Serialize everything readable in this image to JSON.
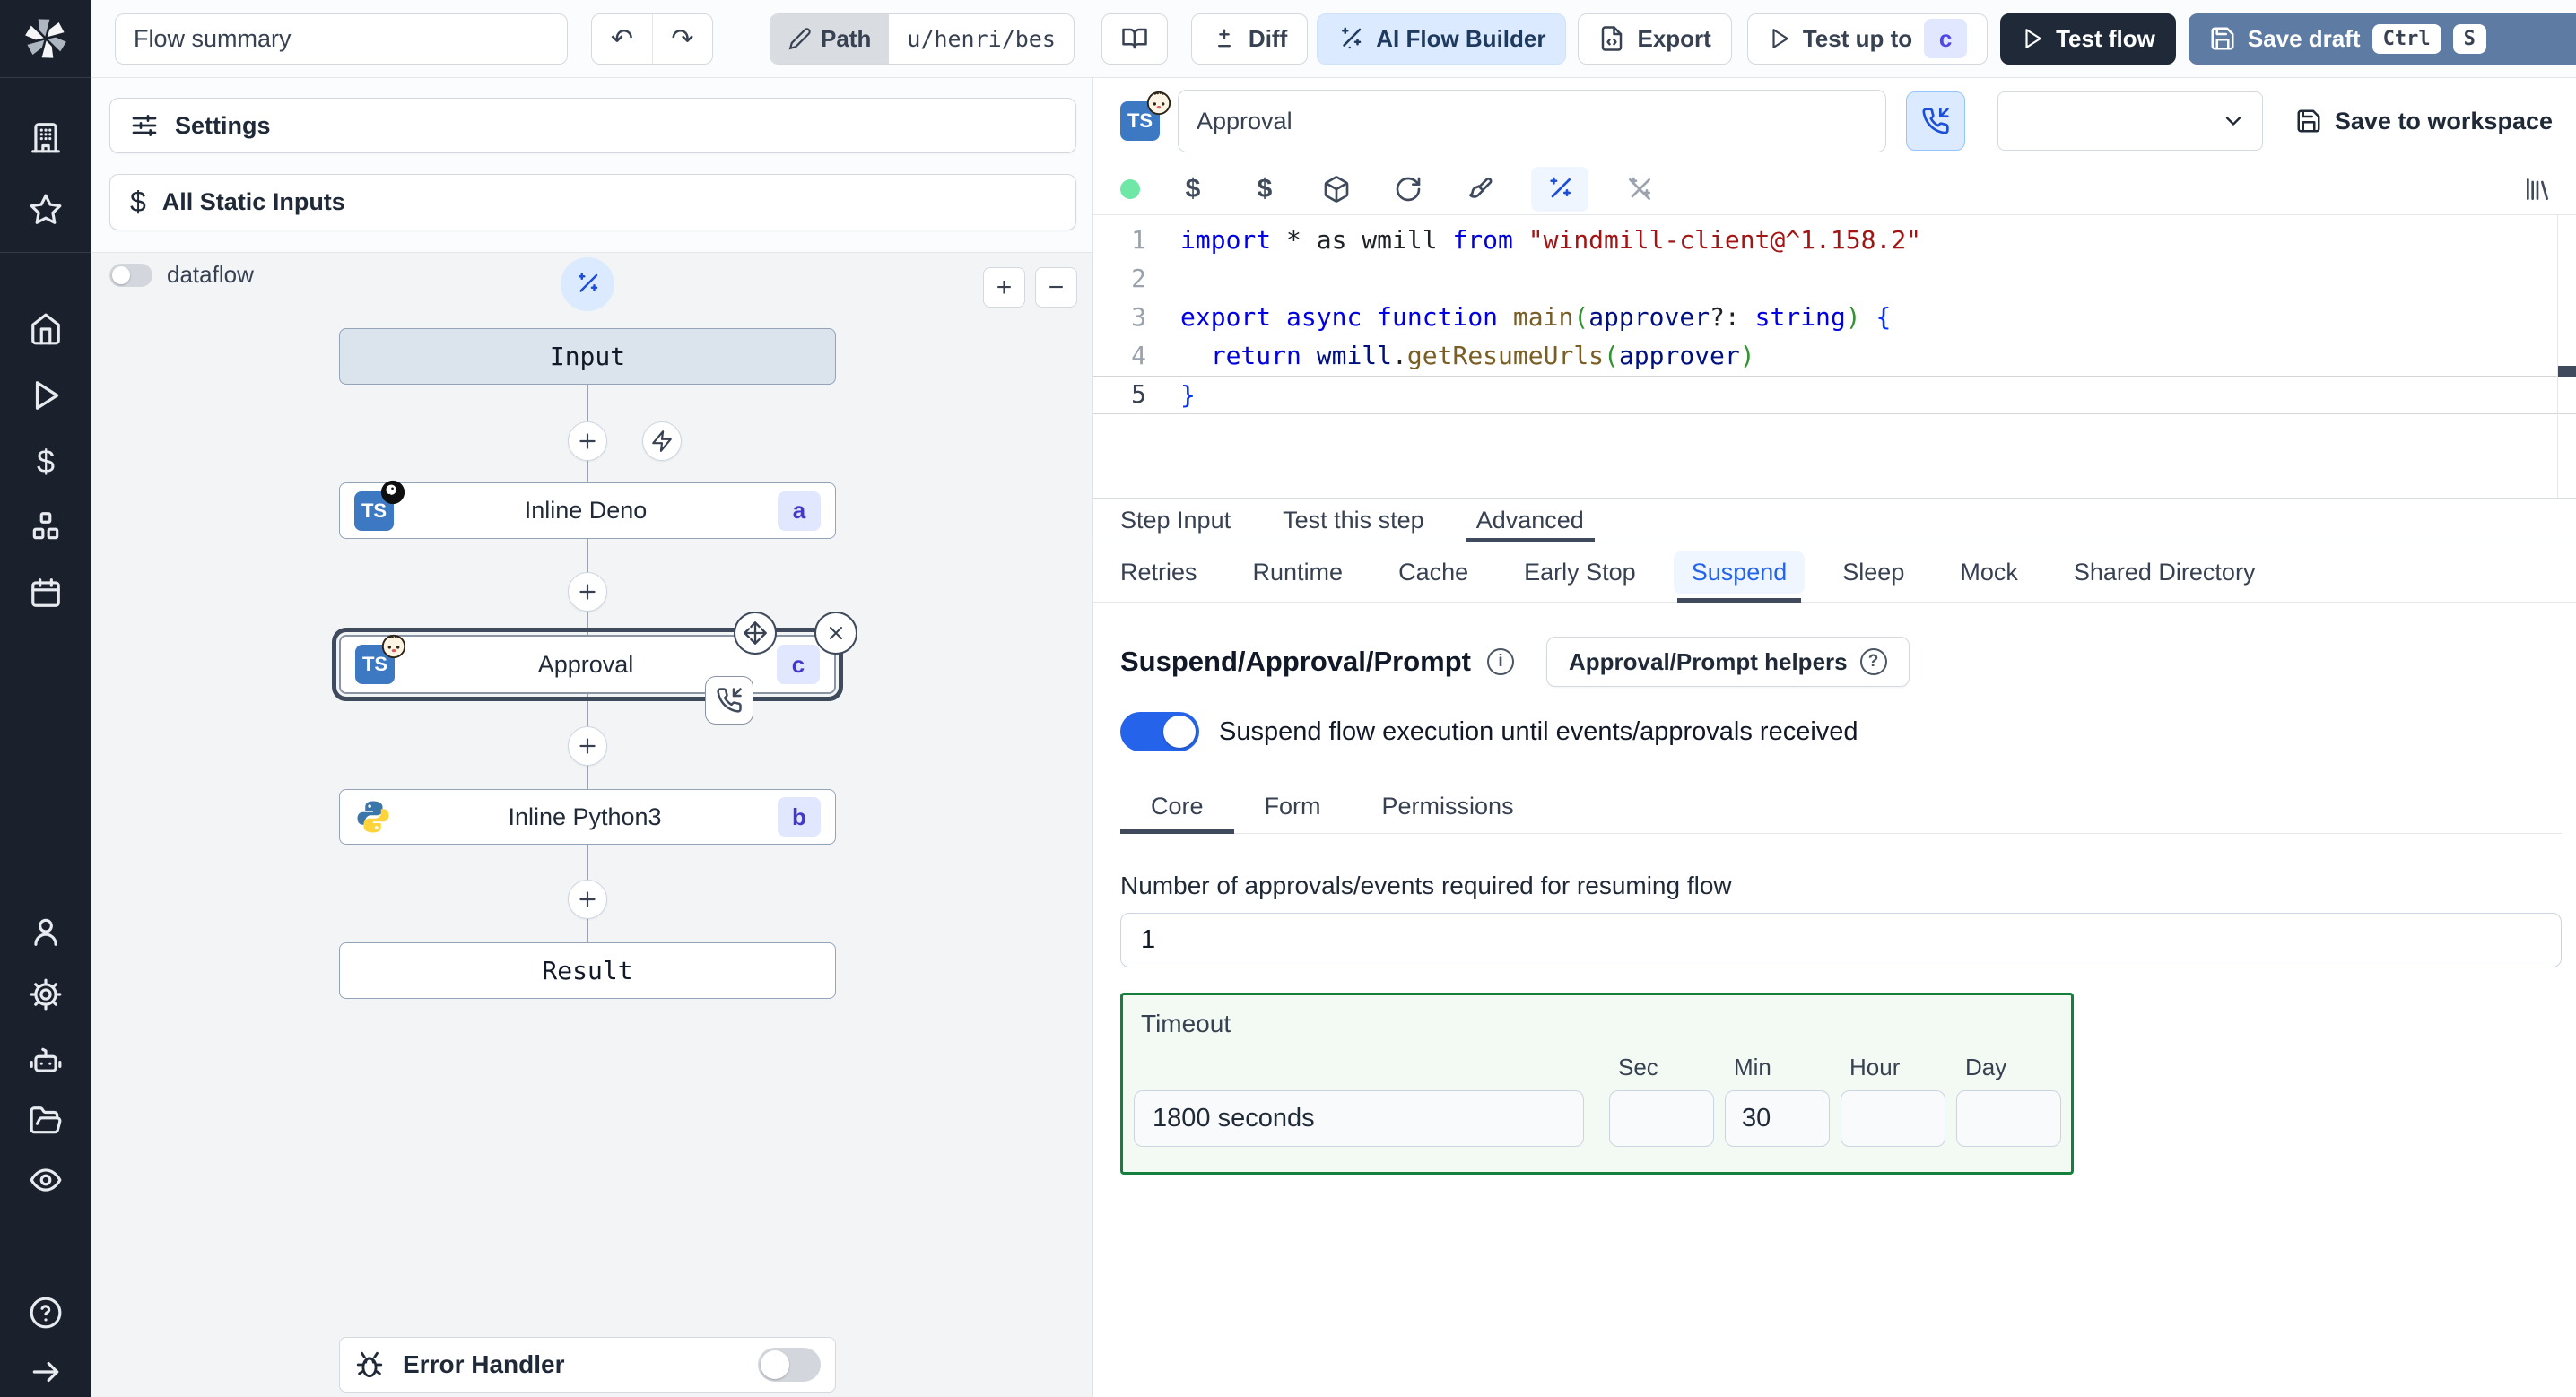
{
  "topbar": {
    "flow_summary": "Flow summary",
    "path_label": "Path",
    "path_value": "u/henri/bes",
    "diff_label": "Diff",
    "ai_builder_label": "AI Flow Builder",
    "export_label": "Export",
    "test_up_to_label": "Test up to",
    "test_up_to_badge": "c",
    "test_flow_label": "Test flow",
    "save_draft_label": "Save draft",
    "kbd_ctrl": "Ctrl",
    "kbd_s": "S"
  },
  "left": {
    "settings": "Settings",
    "all_static_inputs": "All Static Inputs",
    "dataflow": "dataflow",
    "zoom_in": "+",
    "zoom_out": "−",
    "error_handler": "Error Handler"
  },
  "graph": {
    "input_label": "Input",
    "steps": [
      {
        "label": "Inline Deno",
        "badge": "a"
      },
      {
        "label": "Approval",
        "badge": "c"
      },
      {
        "label": "Inline Python3",
        "badge": "b"
      }
    ],
    "result_label": "Result"
  },
  "header": {
    "step_name": "Approval",
    "save_to_workspace": "Save to workspace"
  },
  "editor": {
    "current_line": 5,
    "lines": [
      {
        "n": "1",
        "tokens": [
          {
            "c": "kw",
            "t": "import"
          },
          {
            "c": "pl",
            "t": " * as wmill "
          },
          {
            "c": "kw",
            "t": "from"
          },
          {
            "c": "pl",
            "t": " "
          },
          {
            "c": "str",
            "t": "\"windmill-client@^1.158.2\""
          }
        ]
      },
      {
        "n": "2",
        "tokens": []
      },
      {
        "n": "3",
        "tokens": [
          {
            "c": "kw",
            "t": "export"
          },
          {
            "c": "pl",
            "t": " "
          },
          {
            "c": "kw",
            "t": "async"
          },
          {
            "c": "pl",
            "t": " "
          },
          {
            "c": "kw",
            "t": "function"
          },
          {
            "c": "pl",
            "t": " "
          },
          {
            "c": "fn",
            "t": "main"
          },
          {
            "c": "bg",
            "t": "("
          },
          {
            "c": "vr",
            "t": "approver"
          },
          {
            "c": "pl",
            "t": "?: "
          },
          {
            "c": "kw",
            "t": "string"
          },
          {
            "c": "bg",
            "t": ")"
          },
          {
            "c": "pl",
            "t": " "
          },
          {
            "c": "bb",
            "t": "{"
          }
        ]
      },
      {
        "n": "4",
        "tokens": [
          {
            "c": "pl",
            "t": "  "
          },
          {
            "c": "kw",
            "t": "return"
          },
          {
            "c": "pl",
            "t": " "
          },
          {
            "c": "vr",
            "t": "wmill"
          },
          {
            "c": "pl",
            "t": "."
          },
          {
            "c": "fn",
            "t": "getResumeUrls"
          },
          {
            "c": "bg",
            "t": "("
          },
          {
            "c": "vr",
            "t": "approver"
          },
          {
            "c": "bg",
            "t": ")"
          }
        ]
      },
      {
        "n": "5",
        "tokens": [
          {
            "c": "bb",
            "t": "}"
          }
        ]
      }
    ]
  },
  "tabs": {
    "step": {
      "items": [
        "Step Input",
        "Test this step",
        "Advanced"
      ],
      "active": 2
    },
    "advanced": {
      "items": [
        "Retries",
        "Runtime",
        "Cache",
        "Early Stop",
        "Suspend",
        "Sleep",
        "Mock",
        "Shared Directory"
      ],
      "active": 4
    },
    "core": {
      "items": [
        "Core",
        "Form",
        "Permissions"
      ],
      "active": 0
    }
  },
  "suspend": {
    "title": "Suspend/Approval/Prompt",
    "helpers_button": "Approval/Prompt helpers",
    "toggle_label": "Suspend flow execution until events/approvals received",
    "approvals_label": "Number of approvals/events required for resuming flow",
    "approvals_value": "1",
    "timeout": {
      "label": "Timeout",
      "value": "1800 seconds",
      "units": [
        {
          "label": "Sec",
          "value": ""
        },
        {
          "label": "Min",
          "value": "30"
        },
        {
          "label": "Hour",
          "value": ""
        },
        {
          "label": "Day",
          "value": ""
        }
      ]
    }
  },
  "colors": {
    "toggle_on": "#2563eb",
    "badge_bg": "#e0e7ff",
    "badge_text": "#4338ca",
    "timeout_border": "#15803d",
    "suspend_tab_active": "#2563eb",
    "sidebar_bg": "#1b212c"
  }
}
